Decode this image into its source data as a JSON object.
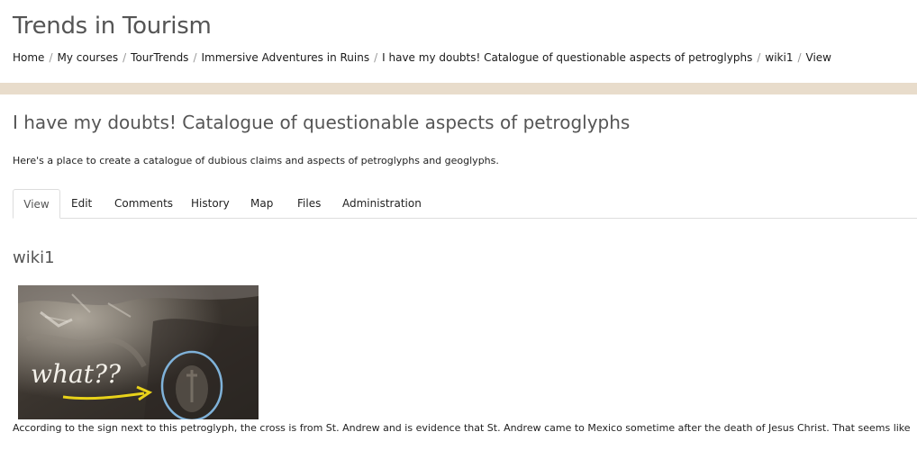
{
  "site": {
    "title": "Trends in Tourism"
  },
  "breadcrumb": [
    {
      "label": "Home"
    },
    {
      "label": "My courses"
    },
    {
      "label": "TourTrends"
    },
    {
      "label": "Immersive Adventures in Ruins"
    },
    {
      "label": "I have my doubts! Catalogue of questionable aspects of petroglyphs"
    },
    {
      "label": "wiki1"
    },
    {
      "label": "View"
    }
  ],
  "breadcrumb_separator": "/",
  "page": {
    "heading": "I have my doubts! Catalogue of questionable aspects of petroglyphs",
    "intro": "Here's a place to create a catalogue of dubious claims and aspects of petroglyphs and geoglyphs."
  },
  "tabs": [
    {
      "label": "View",
      "active": true
    },
    {
      "label": "Edit"
    },
    {
      "label": "Comments"
    },
    {
      "label": "History"
    },
    {
      "label": "Map"
    },
    {
      "label": "Files"
    },
    {
      "label": "Administration"
    }
  ],
  "wiki": {
    "heading": "wiki1",
    "image_annotation": "what??",
    "body": "According to the sign next to this petroglyph, the cross is from St. Andrew and is evidence that St. Andrew came to Mexico sometime after the death of Jesus Christ. That seems like"
  },
  "colors": {
    "band": "#e8dccb",
    "annotation_circle": "#7fb2d9",
    "annotation_arrow": "#e8d21a"
  }
}
